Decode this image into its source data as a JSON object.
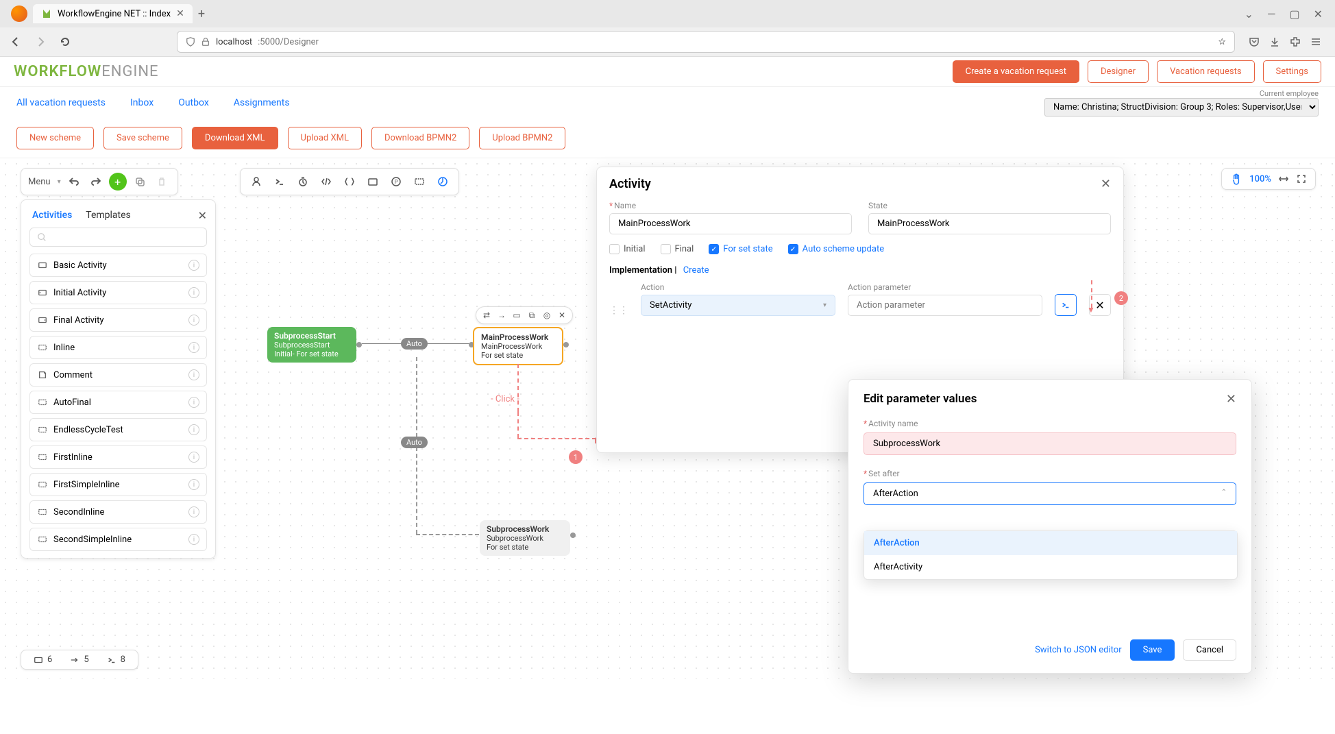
{
  "browser": {
    "tab_title": "WorkflowEngine NET :: Index",
    "url_host": "localhost",
    "url_port_path": ":5000/Designer"
  },
  "logo": {
    "part1": "WORKFLOW",
    "part2": "ENGINE"
  },
  "header_buttons": {
    "create": "Create a vacation request",
    "designer": "Designer",
    "vacation": "Vacation requests",
    "settings": "Settings"
  },
  "subnav": {
    "all": "All vacation requests",
    "inbox": "Inbox",
    "outbox": "Outbox",
    "assignments": "Assignments"
  },
  "employee": {
    "label": "Current employee",
    "value": "Name: Christina; StructDivision: Group 3; Roles: Supervisor,User"
  },
  "actions": {
    "new": "New scheme",
    "save": "Save scheme",
    "dlxml": "Download XML",
    "ulxml": "Upload XML",
    "dlbpmn": "Download BPMN2",
    "ulbpmn": "Upload BPMN2"
  },
  "menu_strip": {
    "menu": "Menu"
  },
  "zoom": {
    "pct": "100%"
  },
  "left_panel": {
    "tab_activities": "Activities",
    "tab_templates": "Templates",
    "items": [
      "Basic Activity",
      "Initial Activity",
      "Final Activity",
      "Inline",
      "Comment",
      "AutoFinal",
      "EndlessCycleTest",
      "FirstInline",
      "FirstSimpleInline",
      "SecondInline",
      "SecondSimpleInline"
    ]
  },
  "nodes": {
    "start": {
      "l1": "SubprocessStart",
      "l2": "SubprocessStart",
      "l3": "Initial- For set state"
    },
    "main": {
      "l1": "MainProcessWork",
      "l2": "MainProcessWork",
      "l3": "For set state"
    },
    "sub": {
      "l1": "SubprocessWork",
      "l2": "SubprocessWork",
      "l3": "For set state"
    },
    "auto": "Auto",
    "click": "- Click -"
  },
  "badges": {
    "b1": "1",
    "b2": "2"
  },
  "status_bar": {
    "states": "6",
    "trans": "5",
    "actions": "8"
  },
  "activity_panel": {
    "title": "Activity",
    "name_label": "Name",
    "name_value": "MainProcessWork",
    "state_label": "State",
    "state_value": "MainProcessWork",
    "chk_initial": "Initial",
    "chk_final": "Final",
    "chk_forset": "For set state",
    "chk_auto": "Auto scheme update",
    "impl": "Implementation",
    "create": "Create",
    "action_label": "Action",
    "action_value": "SetActivity",
    "param_label": "Action parameter",
    "param_placeholder": "Action parameter"
  },
  "edit_panel": {
    "title": "Edit parameter values",
    "actname_label": "Activity name",
    "actname_value": "SubprocessWork",
    "setafter_label": "Set after",
    "setafter_value": "AfterAction",
    "opt1": "AfterAction",
    "opt2": "AfterActivity",
    "switch": "Switch to JSON editor",
    "save": "Save",
    "cancel": "Cancel"
  }
}
